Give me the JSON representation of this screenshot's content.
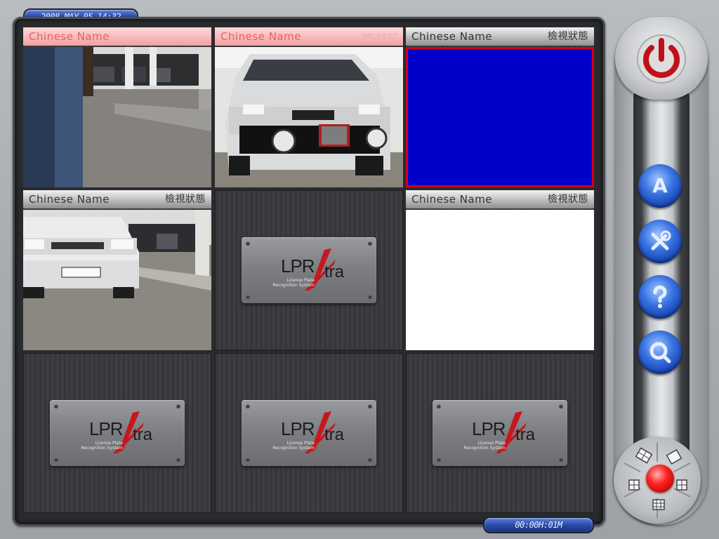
{
  "header": {
    "datetime": "2008-MAY-05 14:32"
  },
  "footer": {
    "counter": "00:00H:01M"
  },
  "logo": {
    "text_lpr": "LPR",
    "text_tra": "tra",
    "subtitle_line1": "License Plate",
    "subtitle_line2": "Recognition System"
  },
  "cells": [
    {
      "name": "Chinese Name",
      "status": "",
      "style": "pink",
      "view": "camera"
    },
    {
      "name": "Chinese Name",
      "status": "ML4637",
      "style": "pink",
      "view": "camera"
    },
    {
      "name": "Chinese Name",
      "status": "檢視狀態",
      "style": "gray",
      "view": "blue-selected"
    },
    {
      "name": "Chinese Name",
      "status": "檢視狀態",
      "style": "gray",
      "view": "camera"
    },
    {
      "view": "logo"
    },
    {
      "name": "Chinese Name",
      "status": "檢視狀態",
      "style": "gray",
      "view": "white"
    },
    {
      "view": "logo"
    },
    {
      "view": "logo"
    },
    {
      "view": "logo"
    }
  ],
  "side_buttons": [
    {
      "label": "A",
      "icon": "letter-a-icon"
    },
    {
      "label": "",
      "icon": "tools-icon"
    },
    {
      "label": "",
      "icon": "help-icon"
    },
    {
      "label": "",
      "icon": "search-icon"
    }
  ],
  "colors": {
    "accent_red": "#d4001a",
    "lcd_blue": "#2747a6",
    "selected_view": "#0000c8"
  }
}
